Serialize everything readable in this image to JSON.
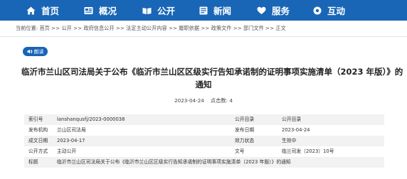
{
  "nav": {
    "home": "首页",
    "overview": "概况",
    "public": "公开",
    "news": "新闻",
    "service": "服务",
    "interaction": "互动"
  },
  "breadcrumb": "当前位置: 首页 >> 公开 >> 政府信息公开 >> 法定主动公开内容 >> 履职依据 >> 政策文件 >> 部门文件 >> 正文",
  "read_button": "朗读",
  "article": {
    "title_line1": "临沂市兰山区司法局关于公布《临沂市兰山区区级实行告知承诺制的证明事项实施清单（2023 年版）》的",
    "title_line2": "通知",
    "date": "2023-04-24",
    "views_label": "点击数:",
    "views": "4"
  },
  "info": {
    "index_label": "索引号",
    "index_value": "lanshanqusfj/2023-0000038",
    "catalog_label": "公开目录",
    "catalog_value": "公开目录",
    "org_label": "发布机构",
    "org_value": "兰山区司法局",
    "pubdate_label": "发布日期",
    "pubdate_value": "2023-04-24",
    "created_label": "成文日期",
    "created_value": "2023-04-17",
    "status_label": "效力状态",
    "status_value": "生效中",
    "mode_label": "公开方式",
    "mode_value": "主动公开",
    "docno_label": "文号",
    "docno_value": "临兰司发〔2023〕10号",
    "topic_label": "标题",
    "topic_value": "临沂市兰山区司法局关于公布《临沂市兰山区区级实行告知承诺制的证明事项实施清单（2023 年版）》的通知"
  },
  "colors": {
    "nav_bg": "#1966b7",
    "read_button_bg": "#1763b8",
    "table_stripe": "#f2f2f2"
  },
  "icons": [
    "home-icon",
    "overview-icon",
    "public-icon",
    "news-icon",
    "service-icon",
    "interaction-icon",
    "speaker-icon"
  ]
}
